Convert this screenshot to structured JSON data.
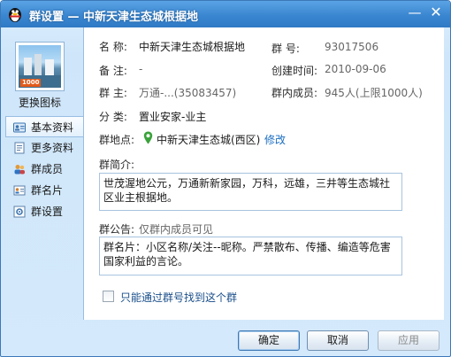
{
  "window": {
    "title": "群设置 — 中新天津生态城根据地",
    "minimize_glyph": "—",
    "close_glyph": "✕"
  },
  "sidebar": {
    "avatar_tag": "1000",
    "change_icon_label": "更换图标",
    "items": [
      {
        "label": "基本资料",
        "icon": "id-card-icon",
        "active": true
      },
      {
        "label": "更多资料",
        "icon": "document-icon",
        "active": false
      },
      {
        "label": "群成员",
        "icon": "members-icon",
        "active": false
      },
      {
        "label": "群名片",
        "icon": "card-icon",
        "active": false
      },
      {
        "label": "群设置",
        "icon": "settings-icon",
        "active": false
      }
    ]
  },
  "info": {
    "name_label": "名  称:",
    "name_value": "中新天津生态城根据地",
    "number_label": "群  号:",
    "number_value": "93017506",
    "remark_label": "备  注:",
    "remark_value": "-",
    "created_label": "创建时间:",
    "created_value": "2010-09-06",
    "owner_label": "群  主:",
    "owner_value": "万通-...(35083457)",
    "members_label": "群内成员:",
    "members_value": "945人(上限1000人)",
    "category_label": "分  类:",
    "category_value": "置业安家-业主",
    "location_label": "群地点:",
    "location_value": "中新天津生态城(西区)",
    "location_edit": "修改",
    "intro_label": "群简介:",
    "intro_text": "世茂渥地公元，万通新新家园，万科，远雄，三井等生态城社区业主根据地。",
    "notice_label": "群公告:",
    "notice_hint": "仅群内成员可见",
    "notice_text": "群名片：小区名称/关注--昵称。严禁散布、传播、编造等危害国家利益的言论。",
    "search_only_label": "只能通过群号找到这个群"
  },
  "buttons": {
    "ok": "确定",
    "cancel": "取消",
    "apply": "应用"
  },
  "colors": {
    "titlebar": "#3a86d0",
    "link": "#1a6ec2",
    "location_pin": "#3aa23a"
  }
}
